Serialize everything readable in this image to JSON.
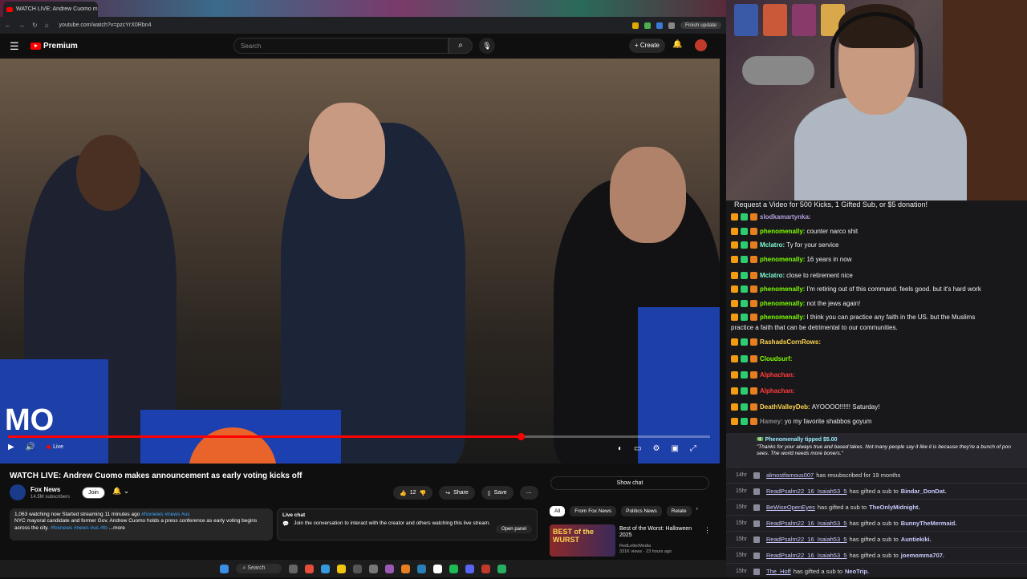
{
  "browser": {
    "tab_title": "WATCH LIVE: Andrew Cuomo m",
    "url": "youtube.com/watch?v=pzcYrX0Rbn4",
    "finish_update": "Finish update"
  },
  "youtube": {
    "logo_text": "Premium",
    "search_placeholder": "Search",
    "create_label": "Create"
  },
  "video": {
    "banner_text": "MO",
    "live_label": "Live",
    "progress_fraction": 0.73
  },
  "details": {
    "title": "WATCH LIVE: Andrew Cuomo makes announcement as early voting kicks off",
    "channel": "Fox News",
    "subscribers": "14.5M subscribers",
    "join_label": "Join",
    "like_count": "12",
    "share_label": "Share",
    "save_label": "Save",
    "desc_line1": "1,063 watching now  Started streaming 11 minutes ago",
    "desc_tags1": "#foxnews #news #us",
    "desc_line2": "NYC mayoral candidate and former Gov. Andrew Cuomo holds a press conference as early voting begins across the city.",
    "desc_tags2": "#foxnews #news #us #fo",
    "desc_more": "...more",
    "livechat_title": "Live chat",
    "livechat_text": "Join the conversation to interact with the creator and others watching this live stream.",
    "open_panel": "Open panel",
    "show_chat": "Show chat"
  },
  "sidebar": {
    "chips": [
      "All",
      "From Fox News",
      "Politics News",
      "Relate"
    ],
    "rec_thumb": "BEST of the WURST",
    "rec_title": "Best of the Worst: Halloween 2025",
    "rec_channel": "RedLetterMedia",
    "rec_meta": "331K views · 23 hours ago"
  },
  "taskbar": {
    "search_label": "Search"
  },
  "stream_chat": {
    "header": "Request a Video for 500 Kicks, 1 Gifted Sub, or $5 donation!",
    "messages": [
      {
        "user": "slodkamartynka:",
        "text": "",
        "color": "#b39ddb"
      },
      {
        "user": "phenomenally:",
        "text": "counter narco shit",
        "color": "#7fff00"
      },
      {
        "user": "Mclatro:",
        "text": "Ty for your service",
        "color": "#7fffd4"
      },
      {
        "user": "phenomenally:",
        "text": "16 years in now",
        "color": "#7fff00"
      },
      {
        "user": "Mclatro:",
        "text": "close to retirement nice",
        "color": "#7fffd4"
      },
      {
        "user": "phenomenally:",
        "text": "I'm retiring out of this command. feels good. but it's hard work",
        "color": "#7fff00"
      },
      {
        "user": "phenomenally:",
        "text": "not the jews again!",
        "color": "#7fff00"
      },
      {
        "user": "phenomenally:",
        "text": "I think you can practice any faith in the US. but the Muslims",
        "color": "#7fff00"
      },
      {
        "user": "",
        "text": "practice a faith that can be detrimental to our communities.",
        "color": "#7fff00"
      },
      {
        "user": "RashadsCornRows:",
        "text": "",
        "color": "#ffd54f"
      },
      {
        "user": "Cloudsurf:",
        "text": "",
        "color": "#7fff00"
      },
      {
        "user": "Alphachan:",
        "text": "",
        "color": "#ff3b3b"
      },
      {
        "user": "Alphachan:",
        "text": "",
        "color": "#ff3b3b"
      },
      {
        "user": "DeathValleyDeb:",
        "text": "AYOOOO!!!!!! Saturday!",
        "color": "#ffd54f"
      },
      {
        "user": "Hamey:",
        "text": "yo my favorite shabbos goyum",
        "color": "#888"
      }
    ]
  },
  "events": {
    "tip_text": "Phenomenally tipped $5.00",
    "tip_message": "\"Thanks for your always true and based takes. Not many people say it like it is because they're a bunch of poo sees. The world needs more boners.\"",
    "rows": [
      {
        "time": "14hr",
        "user": "almostfamous007",
        "action": "has resubscribed for 19 months",
        "target": ""
      },
      {
        "time": "15hr",
        "user": "ReadPsalm22_16_Isaiah53_5",
        "action": "has gifted a sub to",
        "target": "Bindar_DonDat."
      },
      {
        "time": "15hr",
        "user": "BeWiseOpenEyes",
        "action": "has gifted a sub to",
        "target": "TheOnlyMidnight."
      },
      {
        "time": "15hr",
        "user": "ReadPsalm22_16_Isaiah53_5",
        "action": "has gifted a sub to",
        "target": "BunnyTheMermaid."
      },
      {
        "time": "15hr",
        "user": "ReadPsalm22_16_Isaiah53_5",
        "action": "has gifted a sub to",
        "target": "Auntiekiki."
      },
      {
        "time": "15hr",
        "user": "ReadPsalm22_16_Isaiah53_5",
        "action": "has gifted a sub to",
        "target": "joemomma707."
      },
      {
        "time": "15hr",
        "user": "The_Hoff",
        "action": "has gifted a sub to",
        "target": "NeoTrip."
      }
    ]
  }
}
